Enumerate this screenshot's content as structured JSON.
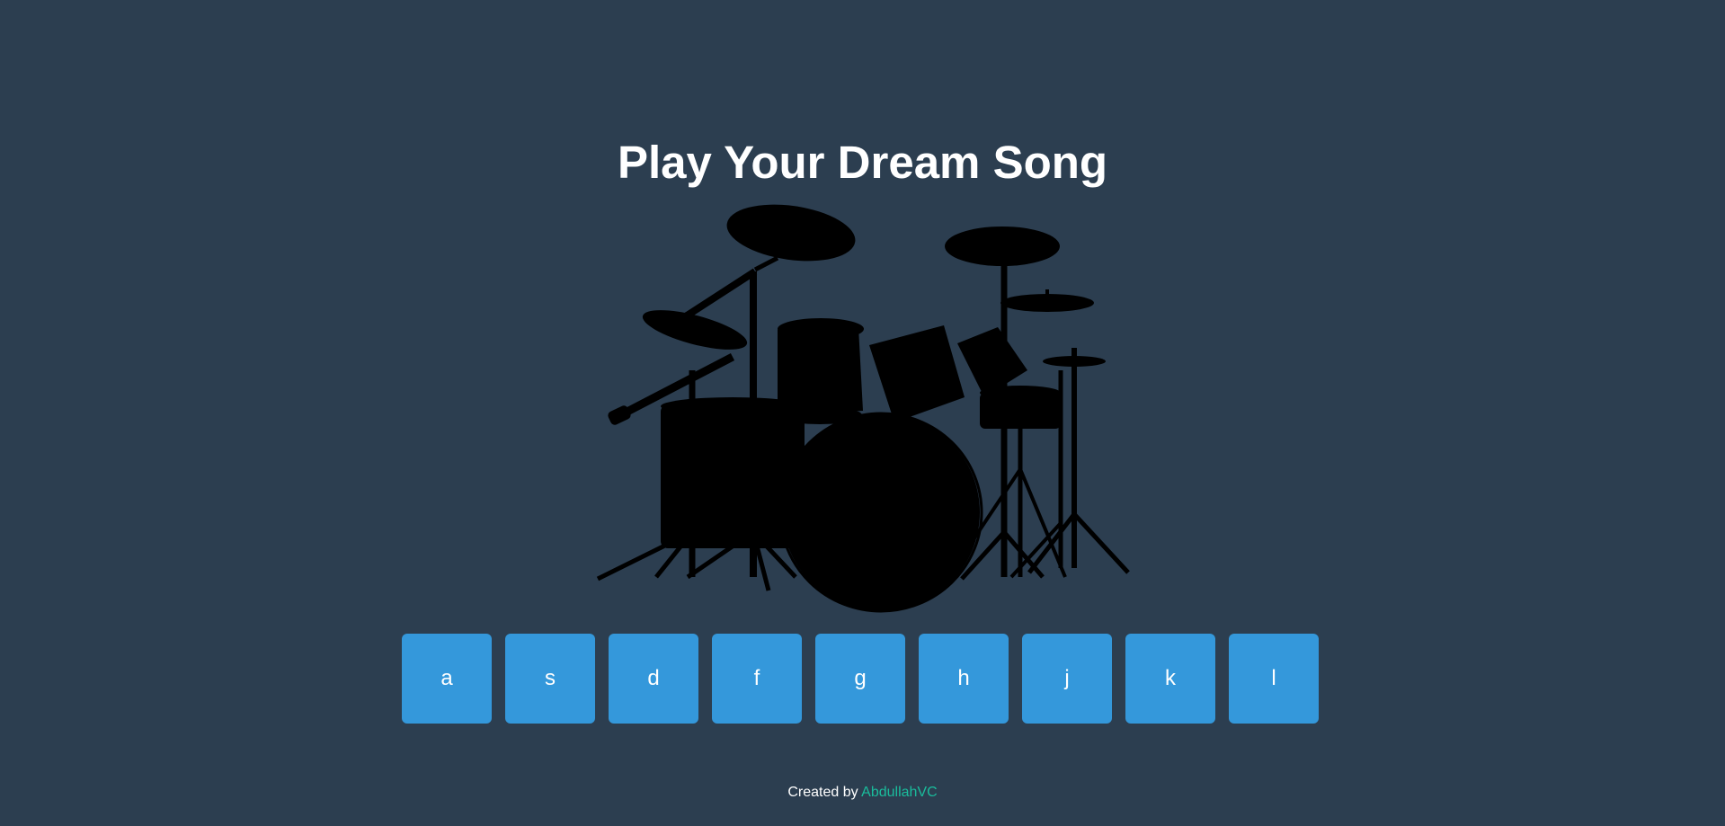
{
  "page": {
    "title": "Play Your Dream Song"
  },
  "drum_image": {
    "icon": "drum-kit-silhouette"
  },
  "keys": [
    {
      "label": "a"
    },
    {
      "label": "s"
    },
    {
      "label": "d"
    },
    {
      "label": "f"
    },
    {
      "label": "g"
    },
    {
      "label": "h"
    },
    {
      "label": "j"
    },
    {
      "label": "k"
    },
    {
      "label": "l"
    }
  ],
  "footer": {
    "prefix": "Created by ",
    "author": "AbdullahVC"
  },
  "colors": {
    "background": "#2c3e50",
    "key": "#3498db",
    "link": "#1abc9c",
    "text": "#ffffff"
  }
}
